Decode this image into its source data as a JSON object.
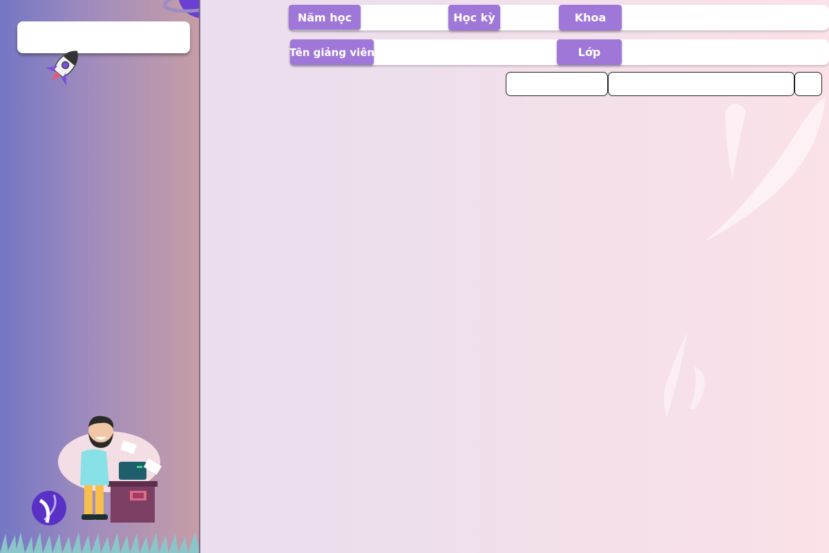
{
  "filters": {
    "row1": {
      "nam_hoc_label": "Năm học",
      "nam_hoc_value": "",
      "hoc_ky_label": "Học kỳ",
      "hoc_ky_value": "",
      "khoa_label": "Khoa",
      "khoa_value": ""
    },
    "row2": {
      "ten_giang_vien_label": "Tên giảng viên",
      "ten_giang_vien_value": "",
      "lop_label": "Lớp",
      "lop_value": ""
    }
  },
  "colors": {
    "chip_accent": "#9f77d8",
    "sidebar_start": "#7476c4",
    "sidebar_end": "#c69da6"
  },
  "icons": {
    "planet": "planet-icon",
    "rocket": "rocket-icon",
    "ball": "ball-icon",
    "person": "person-at-computer-illustration",
    "grass": "grass-decoration"
  }
}
